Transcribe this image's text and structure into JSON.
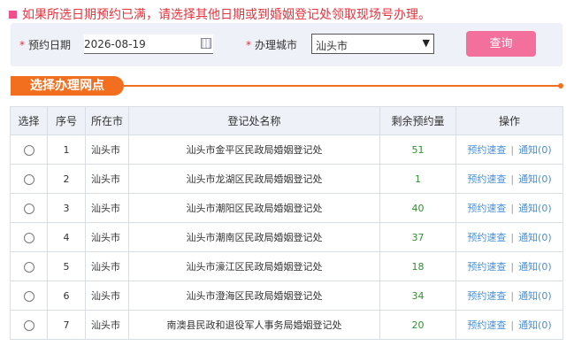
{
  "notice": "如果所选日期预约已满，请选择其他日期或到婚姻登记处领取现场号办理。",
  "filter": {
    "date_label": "预约日期",
    "date_value": "2026-08-19",
    "city_label": "办理城市",
    "city_value": "汕头市",
    "query_label": "查询"
  },
  "section_title": "选择办理网点",
  "table": {
    "headers": [
      "选择",
      "序号",
      "所在市",
      "登记处名称",
      "剩余预约量",
      "操作"
    ],
    "op_book": "预约速查",
    "op_sep": "|",
    "rows": [
      {
        "no": "1",
        "city": "汕头市",
        "name": "汕头市金平区民政局婚姻登记处",
        "remain": "51",
        "notify": "通知(0)"
      },
      {
        "no": "2",
        "city": "汕头市",
        "name": "汕头市龙湖区民政局婚姻登记处",
        "remain": "1",
        "notify": "通知(0)"
      },
      {
        "no": "3",
        "city": "汕头市",
        "name": "汕头市潮阳区民政局婚姻登记处",
        "remain": "40",
        "notify": "通知(0)"
      },
      {
        "no": "4",
        "city": "汕头市",
        "name": "汕头市潮南区民政局婚姻登记处",
        "remain": "37",
        "notify": "通知(0)"
      },
      {
        "no": "5",
        "city": "汕头市",
        "name": "汕头市濠江区民政局婚姻登记处",
        "remain": "18",
        "notify": "通知(0)"
      },
      {
        "no": "6",
        "city": "汕头市",
        "name": "汕头市澄海区民政局婚姻登记处",
        "remain": "34",
        "notify": "通知(0)"
      },
      {
        "no": "7",
        "city": "汕头市",
        "name": "南澳县民政和退役军人事务局婚姻登记处",
        "remain": "20",
        "notify": "通知(0)"
      }
    ]
  }
}
